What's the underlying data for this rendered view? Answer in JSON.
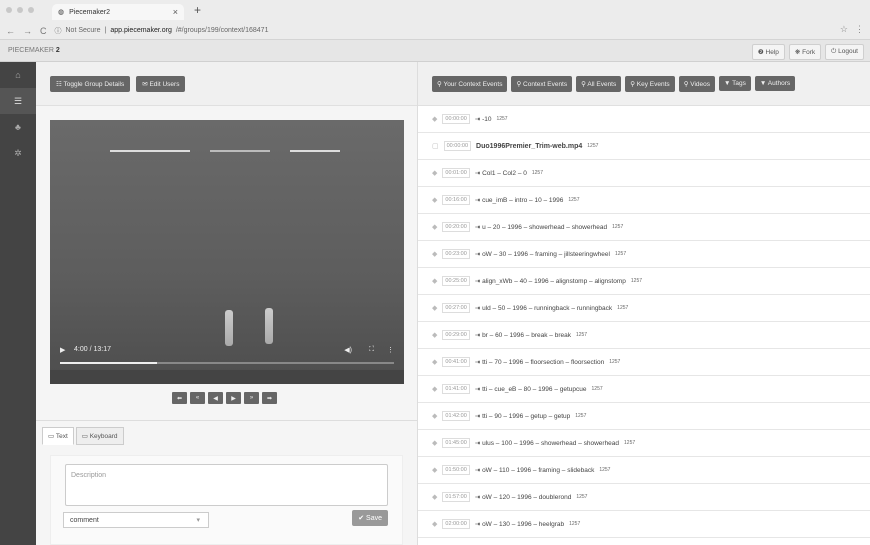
{
  "browser": {
    "tab_title": "Piecemaker2",
    "tab_close": "×",
    "new_tab": "+",
    "security": "Not Secure",
    "url_domain": "app.piecemaker.org",
    "url_path": "/#/groups/199/context/168471",
    "nav": [
      "←",
      "→",
      "C",
      "ⓘ"
    ],
    "star": "☆",
    "menu": "⋮"
  },
  "app": {
    "brand_prefix": "PIECEMAKER",
    "brand_suffix": "2",
    "buttons": [
      "❷ Help",
      "❋ Fork",
      "⏻ Logout"
    ]
  },
  "sidebar": {
    "items": [
      {
        "icon": "home-icon",
        "glyph": "⌂"
      },
      {
        "icon": "list-icon",
        "glyph": "☰"
      },
      {
        "icon": "users-icon",
        "glyph": "♣"
      },
      {
        "icon": "gear-icon",
        "glyph": "✲"
      }
    ]
  },
  "left": {
    "buttons": [
      "☷ Toggle Group Details",
      "✉ Edit Users"
    ]
  },
  "video": {
    "play": "▶",
    "time": "4:00 / 13:17",
    "volume": "◀)",
    "fullscreen": "⛶",
    "more": "⋮",
    "progress": 0.29
  },
  "step_buttons": [
    "⬅",
    "«",
    "◀",
    "▶",
    "»",
    "➡"
  ],
  "editor": {
    "tabs": [
      "▭ Text",
      "▭ Keyboard"
    ],
    "placeholder": "Description",
    "select_value": "comment",
    "select_caret": "▾",
    "save": "✔ Save"
  },
  "right": {
    "buttons": [
      "⚲ Your Context Events",
      "⚲ Context Events",
      "⚲ All Events",
      "⚲ Key Events",
      "⚲ Videos",
      "▼ Tags",
      "▼ Authors"
    ]
  },
  "events": [
    {
      "ts": "00:00:00",
      "text": "⇥ -10",
      "sfx": "1257",
      "bold": false
    },
    {
      "ts": "00:00:00",
      "text": "Duo1996Premier_Trim-web.mp4",
      "sfx": "1257",
      "bold": true
    },
    {
      "ts": "00:01:00",
      "text": "⇥ Col1 – Col2 – 0",
      "sfx": "1257",
      "bold": false
    },
    {
      "ts": "00:16:00",
      "text": "⇥ cue_imB – intro – 10 – 1996",
      "sfx": "1257",
      "bold": false
    },
    {
      "ts": "00:20:00",
      "text": "⇥ u – 20 – 1996 – showerhead – showerhead",
      "sfx": "1257",
      "bold": false
    },
    {
      "ts": "00:23:00",
      "text": "⇥ oW – 30 – 1996 – framing – jillsteeringwheel",
      "sfx": "1257",
      "bold": false
    },
    {
      "ts": "00:25:00",
      "text": "⇥ align_xWb – 40 – 1996 – alignstomp – alignstomp",
      "sfx": "1257",
      "bold": false
    },
    {
      "ts": "00:27:00",
      "text": "⇥ uld – 50 – 1996 – runningback – runningback",
      "sfx": "1257",
      "bold": false
    },
    {
      "ts": "00:29:00",
      "text": "⇥ br – 60 – 1996 – break – break",
      "sfx": "1257",
      "bold": false
    },
    {
      "ts": "00:41:00",
      "text": "⇥ tti – 70 – 1996 – floorsection – floorsection",
      "sfx": "1257",
      "bold": false
    },
    {
      "ts": "01:41:00",
      "text": "⇥ tti – cue_eB – 80 – 1996 – getupcue",
      "sfx": "1257",
      "bold": false
    },
    {
      "ts": "01:42:00",
      "text": "⇥ tti – 90 – 1996 – getup – getup",
      "sfx": "1257",
      "bold": false
    },
    {
      "ts": "01:45:00",
      "text": "⇥ ulus – 100 – 1996 – showerhead – showerhead",
      "sfx": "1257",
      "bold": false
    },
    {
      "ts": "01:50:00",
      "text": "⇥ oW – 110 – 1996 – framing – slideback",
      "sfx": "1257",
      "bold": false
    },
    {
      "ts": "01:57:00",
      "text": "⇥ oW – 120 – 1996 – doublerond",
      "sfx": "1257",
      "bold": false
    },
    {
      "ts": "02:00:00",
      "text": "⇥ oW – 130 – 1996 – heelgrab",
      "sfx": "1257",
      "bold": false
    }
  ]
}
